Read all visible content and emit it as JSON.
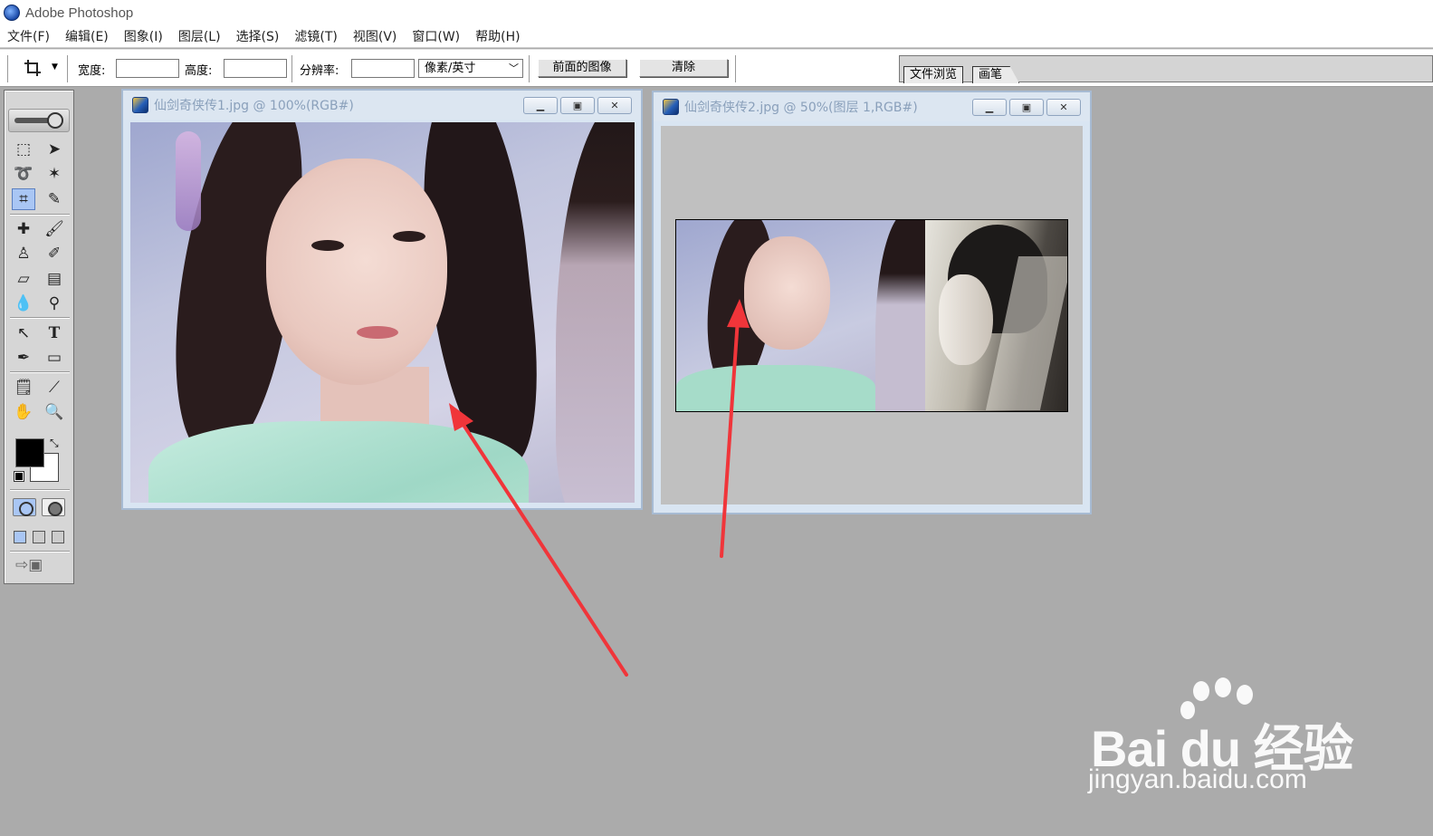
{
  "app": {
    "title": "Adobe Photoshop"
  },
  "menu": [
    "文件(F)",
    "编辑(E)",
    "图象(I)",
    "图层(L)",
    "选择(S)",
    "滤镜(T)",
    "视图(V)",
    "窗口(W)",
    "帮助(H)"
  ],
  "options": {
    "width_label": "宽度:",
    "height_label": "高度:",
    "resolution_label": "分辨率:",
    "width_value": "",
    "height_value": "",
    "resolution_value": "",
    "unit_selected": "像素/英寸",
    "front_image_button": "前面的图像",
    "clear_button": "清除"
  },
  "palette_well": {
    "tabs": [
      "文件浏览",
      "画笔"
    ]
  },
  "colors": {
    "foreground": "#000000",
    "background": "#ffffff",
    "annotation_arrow": "#f0353a",
    "app_background": "#ababab"
  },
  "toolbox": {
    "tools": [
      "marquee-icon",
      "move-icon",
      "lasso-icon",
      "magic-wand-icon",
      "crop-icon",
      "slice-icon",
      "healing-brush-icon",
      "brush-icon",
      "clone-stamp-icon",
      "history-brush-icon",
      "eraser-icon",
      "gradient-icon",
      "blur-icon",
      "dodge-icon",
      "path-selection-icon",
      "type-icon",
      "pen-icon",
      "shape-icon",
      "notes-icon",
      "eyedropper-icon",
      "hand-icon",
      "zoom-icon"
    ],
    "active_tool": "crop-icon"
  },
  "documents": [
    {
      "title": "仙剑奇侠传1.jpg @ 100%(RGB#)",
      "controls": [
        "minimize",
        "maximize",
        "close"
      ]
    },
    {
      "title": "仙剑奇侠传2.jpg @ 50%(图层 1,RGB#)",
      "controls": [
        "minimize",
        "maximize",
        "close"
      ]
    }
  ],
  "watermark": {
    "brand": "Bai du 经验",
    "domain": "jingyan.baidu.com"
  }
}
